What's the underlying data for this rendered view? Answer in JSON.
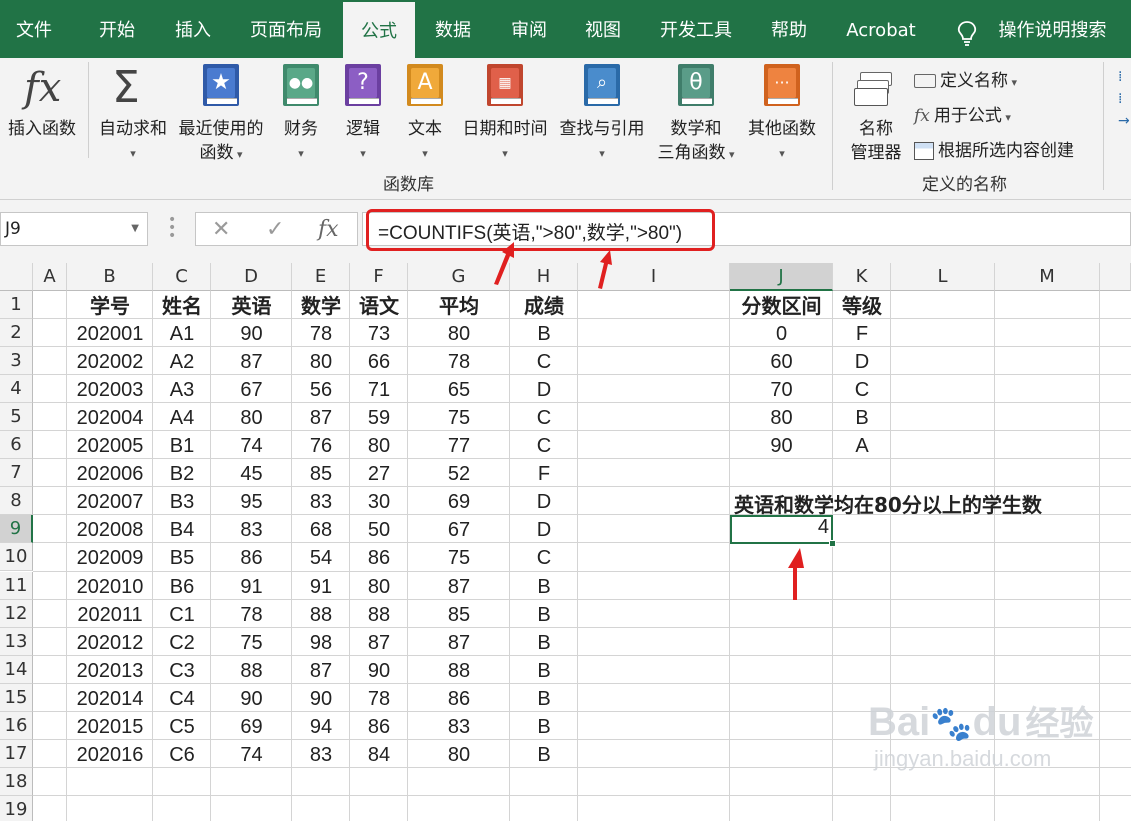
{
  "ribbon_tabs": [
    {
      "label": "文件",
      "active": false
    },
    {
      "label": "开始",
      "active": false
    },
    {
      "label": "插入",
      "active": false
    },
    {
      "label": "页面布局",
      "active": false
    },
    {
      "label": "公式",
      "active": true
    },
    {
      "label": "数据",
      "active": false
    },
    {
      "label": "审阅",
      "active": false
    },
    {
      "label": "视图",
      "active": false
    },
    {
      "label": "开发工具",
      "active": false
    },
    {
      "label": "帮助",
      "active": false
    },
    {
      "label": "Acrobat",
      "active": false
    }
  ],
  "tell_me": "操作说明搜索",
  "ribbon": {
    "insert_function": "插入函数",
    "autosum": "自动求和",
    "recently_used_1": "最近使用的",
    "recently_used_2": "函数",
    "financial": "财务",
    "logical": "逻辑",
    "text": "文本",
    "date_time": "日期和时间",
    "lookup_reference": "查找与引用",
    "math_trig_1": "数学和",
    "math_trig_2": "三角函数",
    "more_functions": "其他函数",
    "group_function_library": "函数库",
    "name_manager_1": "名称",
    "name_manager_2": "管理器",
    "define_name": "定义名称",
    "use_in_formula": "用于公式",
    "create_from_selection": "根据所选内容创建",
    "group_defined_names": "定义的名称"
  },
  "icons": {
    "fx": "fx",
    "sigma": "Σ",
    "star": "★",
    "question": "?",
    "text_a": "A",
    "theta": "θ",
    "more": "···"
  },
  "formula_bar": {
    "name_box": "J9",
    "formula": "=COUNTIFS(英语,\">80\",数学,\">80\")"
  },
  "columns": [
    "A",
    "B",
    "C",
    "D",
    "E",
    "F",
    "G",
    "H",
    "I",
    "J",
    "K",
    "L",
    "M"
  ],
  "rows": [
    "1",
    "2",
    "3",
    "4",
    "5",
    "6",
    "7",
    "8",
    "9",
    "10",
    "11",
    "12",
    "13",
    "14",
    "15",
    "16",
    "17",
    "18",
    "19"
  ],
  "table": {
    "headers": [
      "学号",
      "姓名",
      "英语",
      "数学",
      "语文",
      "平均",
      "成绩"
    ],
    "rows": [
      [
        "202001",
        "A1",
        "90",
        "78",
        "73",
        "80",
        "B"
      ],
      [
        "202002",
        "A2",
        "87",
        "80",
        "66",
        "78",
        "C"
      ],
      [
        "202003",
        "A3",
        "67",
        "56",
        "71",
        "65",
        "D"
      ],
      [
        "202004",
        "A4",
        "80",
        "87",
        "59",
        "75",
        "C"
      ],
      [
        "202005",
        "B1",
        "74",
        "76",
        "80",
        "77",
        "C"
      ],
      [
        "202006",
        "B2",
        "45",
        "85",
        "27",
        "52",
        "F"
      ],
      [
        "202007",
        "B3",
        "95",
        "83",
        "30",
        "69",
        "D"
      ],
      [
        "202008",
        "B4",
        "83",
        "68",
        "50",
        "67",
        "D"
      ],
      [
        "202009",
        "B5",
        "86",
        "54",
        "86",
        "75",
        "C"
      ],
      [
        "202010",
        "B6",
        "91",
        "91",
        "80",
        "87",
        "B"
      ],
      [
        "202011",
        "C1",
        "78",
        "88",
        "88",
        "85",
        "B"
      ],
      [
        "202012",
        "C2",
        "75",
        "98",
        "87",
        "87",
        "B"
      ],
      [
        "202013",
        "C3",
        "88",
        "87",
        "90",
        "88",
        "B"
      ],
      [
        "202014",
        "C4",
        "90",
        "90",
        "78",
        "86",
        "B"
      ],
      [
        "202015",
        "C5",
        "69",
        "94",
        "86",
        "83",
        "B"
      ],
      [
        "202016",
        "C6",
        "74",
        "83",
        "84",
        "80",
        "B"
      ]
    ]
  },
  "grade_table": {
    "headers": [
      "分数区间",
      "等级"
    ],
    "rows": [
      [
        "0",
        "F"
      ],
      [
        "60",
        "D"
      ],
      [
        "70",
        "C"
      ],
      [
        "80",
        "B"
      ],
      [
        "90",
        "A"
      ]
    ]
  },
  "note": "英语和数学均在80分以上的学生数",
  "result": "4",
  "watermark": {
    "logo": "Bai",
    "du": "du",
    "cn": "经验",
    "url": "jingyan.baidu.com"
  },
  "colors": {
    "excel_green": "#217346",
    "highlight_red": "#e02020"
  }
}
